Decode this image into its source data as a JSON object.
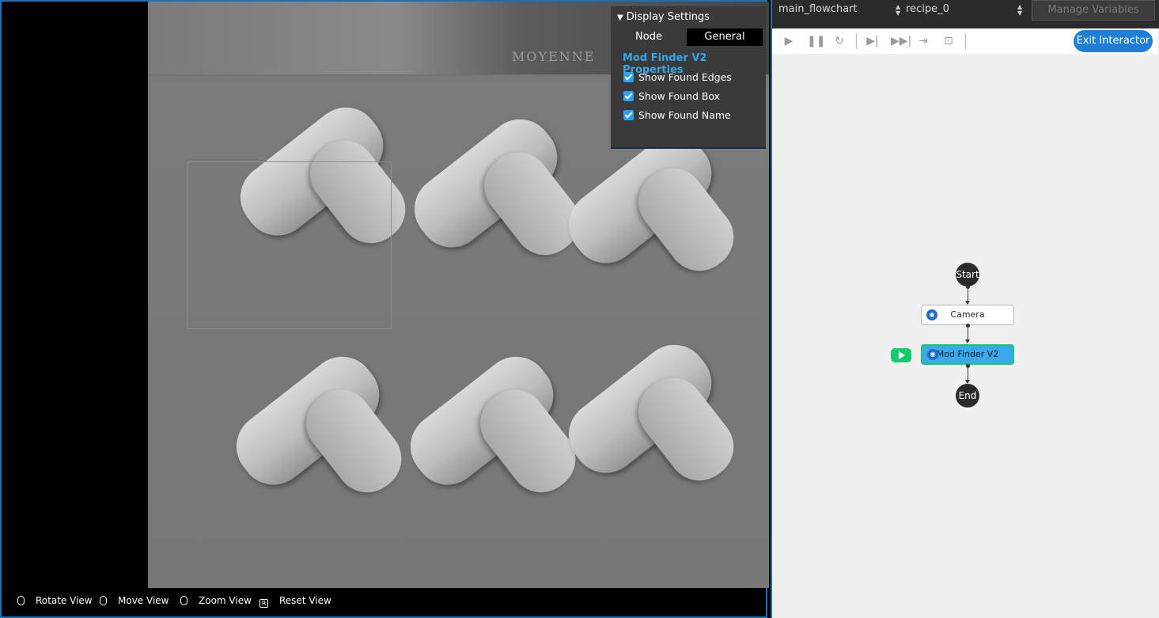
{
  "display_settings": {
    "header": "Display Settings",
    "tabs": [
      "Node",
      "General"
    ],
    "active_tab": "General",
    "section_title": "Mod Finder V2 Properties",
    "checkboxes": [
      {
        "label": "Show Found Edges",
        "checked": true
      },
      {
        "label": "Show Found Box",
        "checked": true
      },
      {
        "label": "Show Found Name",
        "checked": true
      }
    ]
  },
  "image": {
    "box_print": "MOYENNE"
  },
  "view_hints": [
    {
      "label": "Rotate View",
      "icon": "mouse-left-icon"
    },
    {
      "label": "Move View",
      "icon": "mouse-right-icon"
    },
    {
      "label": "Zoom View",
      "icon": "mouse-wheel-icon"
    },
    {
      "label": "Reset View",
      "icon": "r-key-icon",
      "key": "R"
    }
  ],
  "flow_panel": {
    "flowchart_select": "main_flowchart",
    "recipe_select": "recipe_0",
    "manage_variables": "Manage Variables",
    "exit_button": "Exit Interactor",
    "toolbar_icons": [
      "play-icon",
      "pause-icon",
      "restart-icon",
      "step-icon",
      "step-over-icon",
      "step-into-icon",
      "breakpoint-icon"
    ],
    "nodes": {
      "start": "Start",
      "camera": "Camera",
      "mod_finder": "Mod Finder V2",
      "end": "End"
    }
  },
  "colors": {
    "accent": "#1e7fd4",
    "active_node": "#3aa8ea",
    "active_border": "#17c96d",
    "section_title": "#35a7e8"
  }
}
